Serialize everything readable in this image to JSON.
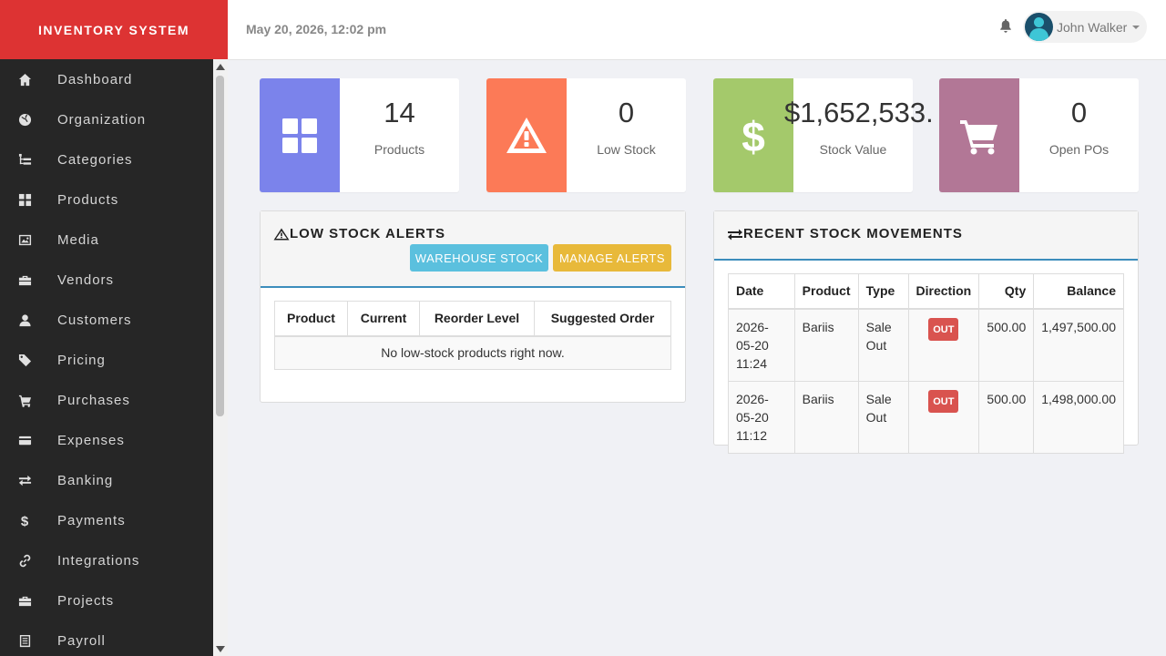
{
  "sidebar": {
    "brand": "INVENTORY SYSTEM",
    "items": [
      {
        "label": "Dashboard",
        "icon": "home-icon"
      },
      {
        "label": "Organization",
        "icon": "globe-icon"
      },
      {
        "label": "Categories",
        "icon": "tree-icon"
      },
      {
        "label": "Products",
        "icon": "grid-icon"
      },
      {
        "label": "Media",
        "icon": "image-icon"
      },
      {
        "label": "Vendors",
        "icon": "briefcase-icon"
      },
      {
        "label": "Customers",
        "icon": "user-icon"
      },
      {
        "label": "Pricing",
        "icon": "tag-icon"
      },
      {
        "label": "Purchases",
        "icon": "cart-icon"
      },
      {
        "label": "Expenses",
        "icon": "card-icon"
      },
      {
        "label": "Banking",
        "icon": "transfer-icon"
      },
      {
        "label": "Payments",
        "icon": "dollar-icon"
      },
      {
        "label": "Integrations",
        "icon": "link-icon"
      },
      {
        "label": "Projects",
        "icon": "briefcase-icon"
      },
      {
        "label": "Payroll",
        "icon": "list-icon"
      }
    ]
  },
  "header": {
    "datetime": "May 20, 2026, 12:02 pm",
    "user_name": "John Walker"
  },
  "stats": [
    {
      "value": "14",
      "label": "Products",
      "color": "#7b83eb",
      "icon": "grid-icon"
    },
    {
      "value": "0",
      "label": "Low Stock",
      "color": "#fc7a57",
      "icon": "warning-icon"
    },
    {
      "value": "$1,652,533.",
      "label": "Stock Value",
      "color": "#a4c96b",
      "icon": "dollar-icon"
    },
    {
      "value": "0",
      "label": "Open POs",
      "color": "#b27796",
      "icon": "cart-icon"
    }
  ],
  "low_stock": {
    "title": "LOW STOCK ALERTS",
    "warehouse_button": "WAREHOUSE STOCK",
    "manage_button": "MANAGE ALERTS",
    "columns": [
      "Product",
      "Current",
      "Reorder Level",
      "Suggested Order"
    ],
    "empty_message": "No low-stock products right now."
  },
  "movements": {
    "title": "RECENT STOCK MOVEMENTS",
    "columns": [
      "Date",
      "Product",
      "Type",
      "Direction",
      "Qty",
      "Balance"
    ],
    "rows": [
      {
        "date": "2026-05-20 11:24",
        "product": "Bariis",
        "type": "Sale Out",
        "direction": "OUT",
        "qty": "500.00",
        "balance": "1,497,500.00"
      },
      {
        "date": "2026-05-20 11:12",
        "product": "Bariis",
        "type": "Sale Out",
        "direction": "OUT",
        "qty": "500.00",
        "balance": "1,498,000.00"
      }
    ]
  },
  "colors": {
    "brand": "#dd3333",
    "sidebar": "#262626",
    "info_button": "#5bc0de",
    "warning_button": "#e8b93a",
    "danger_badge": "#d9534f"
  }
}
